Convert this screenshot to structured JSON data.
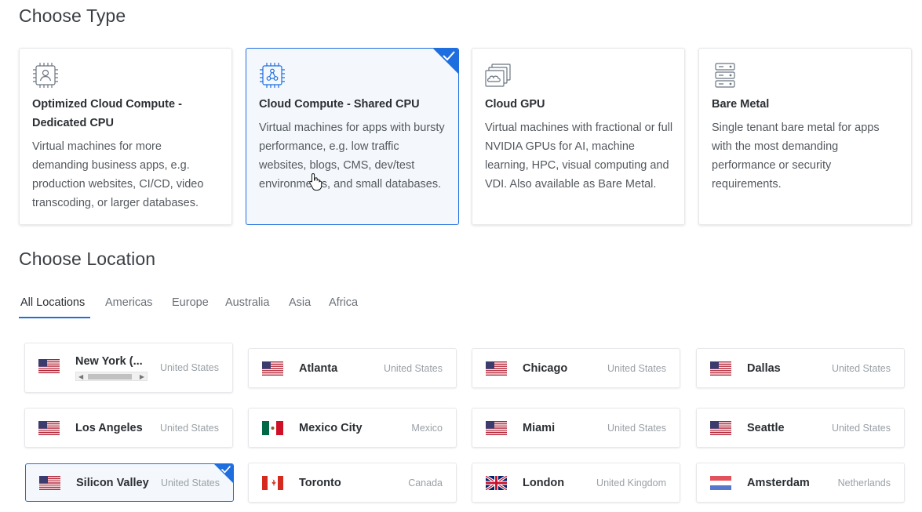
{
  "type_section": {
    "title": "Choose Type",
    "cards": [
      {
        "name": "Optimized Cloud Compute - Dedicated CPU",
        "description": "Virtual machines for more demanding business apps, e.g. production websites, CI/CD, video transcoding, or larger databases.",
        "icon": "chip-user-icon",
        "selected": false
      },
      {
        "name": "Cloud Compute - Shared CPU",
        "description": "Virtual machines for apps with bursty performance, e.g. low traffic websites, blogs, CMS, dev/test environments, and small databases.",
        "icon": "chip-network-icon",
        "selected": true
      },
      {
        "name": "Cloud GPU",
        "description": "Virtual machines with fractional or full NVIDIA GPUs for AI, machine learning, HPC, visual computing and VDI. Also available as Bare Metal.",
        "icon": "gpu-cloud-icon",
        "selected": false
      },
      {
        "name": "Bare Metal",
        "description": "Single tenant bare metal for apps with the most demanding performance or security requirements.",
        "icon": "server-rack-icon",
        "selected": false
      }
    ]
  },
  "location_section": {
    "title": "Choose Location",
    "tabs": [
      "All Locations",
      "Americas",
      "Europe",
      "Australia",
      "Asia",
      "Africa"
    ],
    "active_tab": "All Locations",
    "locations": [
      {
        "city": "New York (...",
        "country": "United States",
        "flag": "us",
        "selected": false
      },
      {
        "city": "Atlanta",
        "country": "United States",
        "flag": "us",
        "selected": false
      },
      {
        "city": "Chicago",
        "country": "United States",
        "flag": "us",
        "selected": false
      },
      {
        "city": "Dallas",
        "country": "United States",
        "flag": "us",
        "selected": false
      },
      {
        "city": "Los Angeles",
        "country": "United States",
        "flag": "us",
        "selected": false
      },
      {
        "city": "Mexico City",
        "country": "Mexico",
        "flag": "mx",
        "selected": false
      },
      {
        "city": "Miami",
        "country": "United States",
        "flag": "us",
        "selected": false
      },
      {
        "city": "Seattle",
        "country": "United States",
        "flag": "us",
        "selected": false
      },
      {
        "city": "Silicon Valley",
        "country": "United States",
        "flag": "us",
        "selected": true
      },
      {
        "city": "Toronto",
        "country": "Canada",
        "flag": "ca",
        "selected": false
      },
      {
        "city": "London",
        "country": "United Kingdom",
        "flag": "gb",
        "selected": false
      },
      {
        "city": "Amsterdam",
        "country": "Netherlands",
        "flag": "nl",
        "selected": false
      }
    ]
  },
  "colors": {
    "accent": "#1e6ee0",
    "selected_bg": "#f4f8fd",
    "border": "#e6e8eb"
  }
}
